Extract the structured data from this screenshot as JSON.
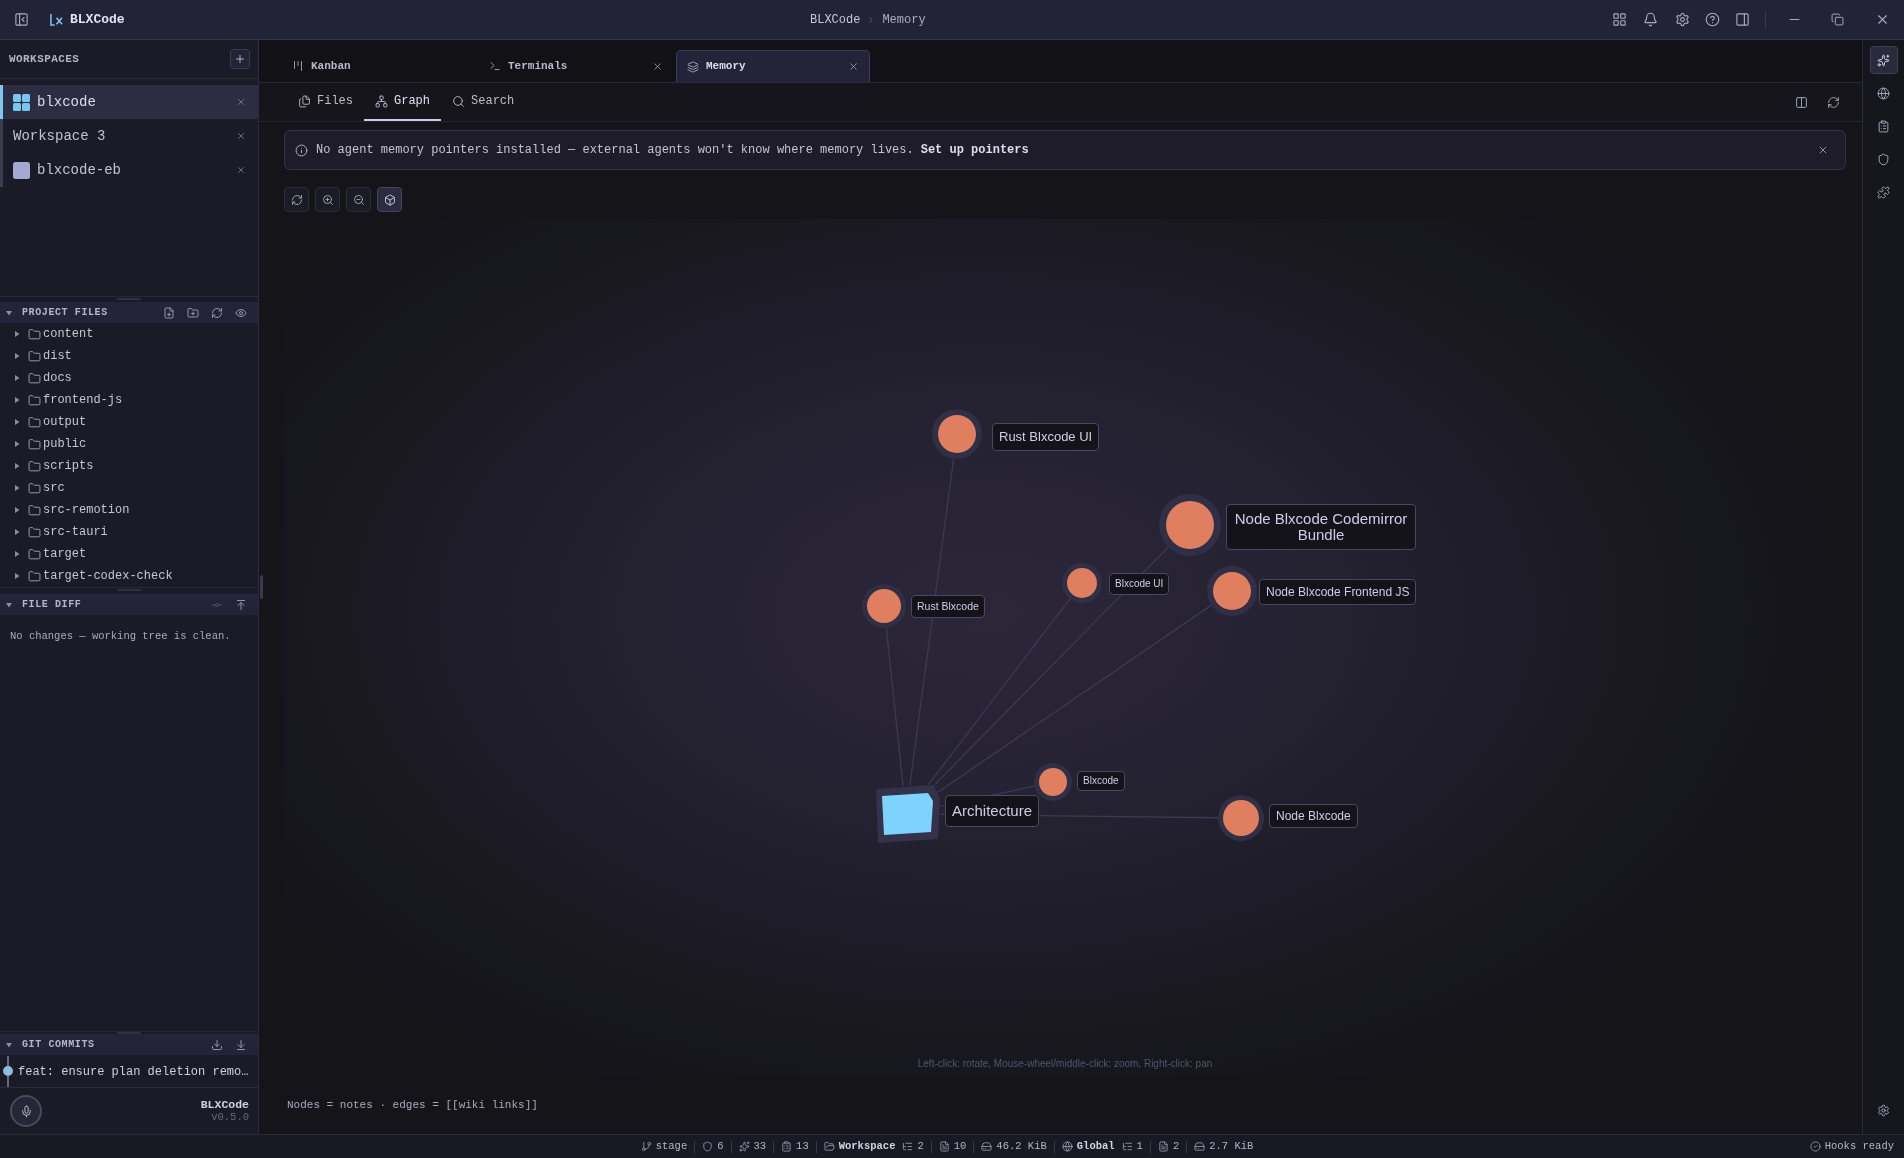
{
  "title_bar": {
    "app_name": "BLXCode",
    "breadcrumb": [
      "BLXCode",
      "Memory"
    ]
  },
  "sidebar": {
    "workspaces": {
      "title": "WORKSPACES",
      "items": [
        {
          "name": "blxcode",
          "kind": "grid",
          "color": "#79c6ef",
          "selected": true
        },
        {
          "name": "Workspace 3",
          "kind": "plain",
          "selected": false
        },
        {
          "name": "blxcode-eb",
          "kind": "square",
          "color": "#a5a8d3",
          "selected": false
        }
      ]
    },
    "project_files": {
      "title": "PROJECT FILES",
      "expanded": true,
      "items": [
        {
          "name": "content",
          "expanded": false
        },
        {
          "name": "dist",
          "expanded": false
        },
        {
          "name": "docs",
          "expanded": false
        },
        {
          "name": "frontend-js",
          "expanded": false
        },
        {
          "name": "output",
          "expanded": false
        },
        {
          "name": "public",
          "expanded": false
        },
        {
          "name": "scripts",
          "expanded": false
        },
        {
          "name": "src",
          "expanded": false
        },
        {
          "name": "src-remotion",
          "expanded": false
        },
        {
          "name": "src-tauri",
          "expanded": false
        },
        {
          "name": "target",
          "expanded": false
        },
        {
          "name": "target-codex-check",
          "expanded": false
        }
      ]
    },
    "file_diff": {
      "title": "FILE DIFF",
      "expanded": true,
      "message": "No changes — working tree is clean."
    },
    "git_commits": {
      "title": "GIT COMMITS",
      "expanded": true,
      "commits": [
        {
          "message": "feat: ensure plan deletion remo…"
        }
      ]
    },
    "footer": {
      "app_name": "BLXCode",
      "version": "v0.5.0"
    }
  },
  "tabs": [
    {
      "label": "Kanban",
      "kind": "kanban",
      "selected": false,
      "closable": false
    },
    {
      "label": "Terminals",
      "kind": "terminal",
      "selected": false,
      "closable": true
    },
    {
      "label": "Memory",
      "kind": "memory",
      "selected": true,
      "closable": true
    }
  ],
  "view_tabs": [
    {
      "label": "Files",
      "kind": "files",
      "selected": false
    },
    {
      "label": "Graph",
      "kind": "graph",
      "selected": true
    },
    {
      "label": "Search",
      "kind": "search",
      "selected": false
    }
  ],
  "banner": {
    "message": "No agent memory pointers installed — external agents won't know where memory lives.",
    "action": "Set up pointers"
  },
  "graph_toolbar": [
    {
      "kind": "refresh",
      "selected": false
    },
    {
      "kind": "zoom-in",
      "selected": false
    },
    {
      "kind": "zoom-out",
      "selected": false
    },
    {
      "kind": "cube",
      "selected": true
    }
  ],
  "graph": {
    "nodes": [
      {
        "label": "Rust Blxcode UI",
        "kind": "sphere"
      },
      {
        "label": "Node Blxcode Codemirror Bundle",
        "kind": "sphere"
      },
      {
        "label": "Blxcode UI",
        "kind": "sphere"
      },
      {
        "label": "Node Blxcode Frontend JS",
        "kind": "sphere"
      },
      {
        "label": "Rust Blxcode",
        "kind": "sphere"
      },
      {
        "label": "Blxcode",
        "kind": "sphere"
      },
      {
        "label": "Architecture",
        "kind": "cube"
      },
      {
        "label": "Node Blxcode",
        "kind": "sphere"
      }
    ],
    "hint": "Left-click: rotate, Mouse-wheel/middle-click: zoom, Right-click: pan"
  },
  "legend": "Nodes = notes · edges = [[wiki links]]",
  "right_rail": [
    {
      "kind": "sparkles",
      "selected": true
    },
    {
      "kind": "globe",
      "selected": false
    },
    {
      "kind": "clipboard",
      "selected": false
    },
    {
      "kind": "shield",
      "selected": false
    },
    {
      "kind": "puzzle",
      "selected": false
    }
  ],
  "status_bar": {
    "segments": [
      {
        "parts": [
          {
            "kind": "branch",
            "text": "stage"
          }
        ]
      },
      {
        "parts": [
          {
            "kind": "shield",
            "text": "6"
          }
        ]
      },
      {
        "parts": [
          {
            "kind": "sparkles",
            "text": "33"
          }
        ]
      },
      {
        "parts": [
          {
            "kind": "clipboard",
            "text": "13"
          }
        ]
      },
      {
        "parts": [
          {
            "kind": "workspace",
            "text": "Workspace"
          },
          {
            "kind": "tree",
            "text": "2"
          }
        ]
      },
      {
        "parts": [
          {
            "kind": "file",
            "text": "10"
          }
        ]
      },
      {
        "parts": [
          {
            "kind": "drive",
            "text": "46.2 KiB"
          }
        ]
      },
      {
        "parts": [
          {
            "kind": "global",
            "text": "Global"
          },
          {
            "kind": "tree",
            "text": "1"
          }
        ]
      },
      {
        "parts": [
          {
            "kind": "file",
            "text": "2"
          }
        ]
      },
      {
        "parts": [
          {
            "kind": "drive",
            "text": "2.7 KiB"
          }
        ]
      }
    ],
    "hooks": "Hooks ready"
  }
}
